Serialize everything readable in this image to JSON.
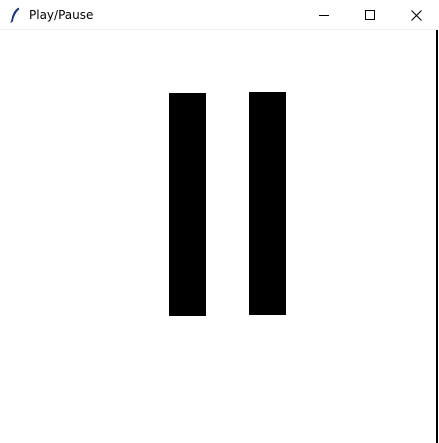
{
  "window": {
    "title": "Play/Pause",
    "icons": {
      "app": "feather-icon",
      "minimize": "minimize-icon",
      "maximize": "maximize-icon",
      "close": "close-icon"
    }
  },
  "canvas": {
    "state": "playing",
    "control_icon": "pause-icon",
    "colors": {
      "background": "#ffffff",
      "bars": "#000000"
    }
  }
}
